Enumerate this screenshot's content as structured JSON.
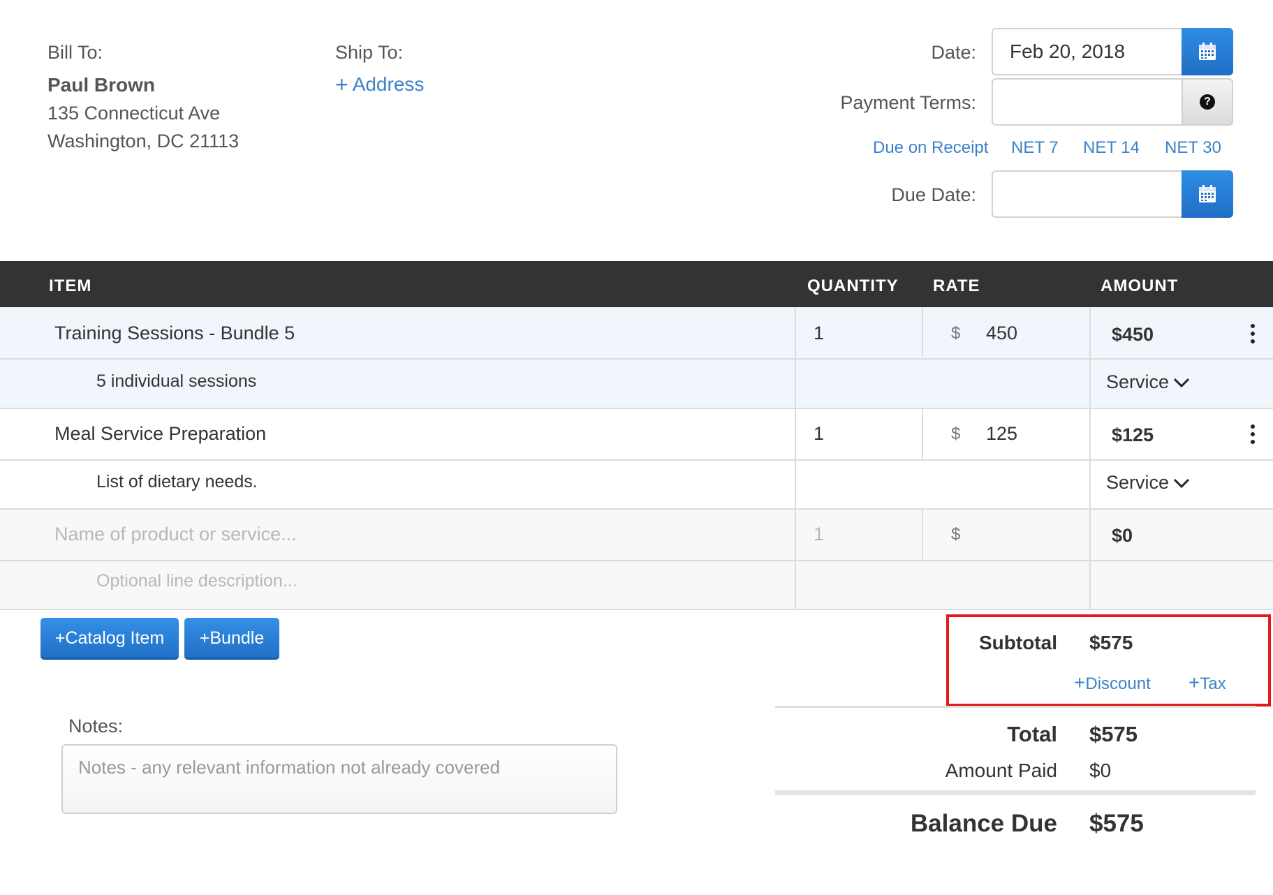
{
  "bill_to": {
    "label": "Bill To:",
    "name": "Paul Brown",
    "address_line1": "135 Connecticut Ave",
    "address_line2": "Washington, DC 21113"
  },
  "ship_to": {
    "label": "Ship To:",
    "add_address": "Address"
  },
  "date": {
    "label": "Date:",
    "value": "Feb 20, 2018"
  },
  "payment_terms": {
    "label": "Payment Terms:",
    "value": "",
    "help_icon": "?",
    "options": [
      "Due on Receipt",
      "NET 7",
      "NET 14",
      "NET 30"
    ]
  },
  "due_date": {
    "label": "Due Date:",
    "value": ""
  },
  "table": {
    "headers": {
      "item": "ITEM",
      "quantity": "QUANTITY",
      "rate": "RATE",
      "amount": "AMOUNT"
    },
    "rows": [
      {
        "name": "Training Sessions - Bundle 5",
        "description": "5 individual sessions",
        "quantity": "1",
        "currency": "$",
        "rate": "450",
        "amount": "$450",
        "type": "Service"
      },
      {
        "name": "Meal Service Preparation",
        "description": "List of dietary needs.",
        "quantity": "1",
        "currency": "$",
        "rate": "125",
        "amount": "$125",
        "type": "Service"
      }
    ],
    "new_row": {
      "name_placeholder": "Name of product or service...",
      "description_placeholder": "Optional line description...",
      "quantity": "1",
      "currency": "$",
      "amount": "$0"
    }
  },
  "buttons": {
    "catalog_item": "Catalog Item",
    "bundle": "Bundle"
  },
  "notes": {
    "label": "Notes:",
    "placeholder": "Notes - any relevant information not already covered"
  },
  "totals": {
    "subtotal_label": "Subtotal",
    "subtotal": "$575",
    "discount_link": "Discount",
    "tax_link": "Tax",
    "total_label": "Total",
    "total": "$575",
    "amount_paid_label": "Amount Paid",
    "amount_paid": "$0",
    "balance_due_label": "Balance Due",
    "balance_due": "$575"
  },
  "colors": {
    "accent": "#3b82c9",
    "header_bg": "#333333",
    "highlight_row": "#f0f6fb",
    "annotation": "#e3191c"
  },
  "icons": {
    "calendar": "calendar-icon",
    "help": "question-circle-icon",
    "kebab": "more-vertical-icon",
    "chevron": "chevron-down-icon",
    "plus": "plus-icon"
  }
}
